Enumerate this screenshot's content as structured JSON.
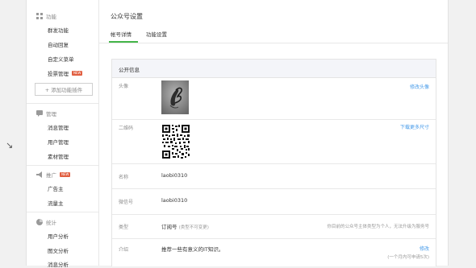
{
  "sidebar": {
    "sections": [
      {
        "title": "功能",
        "icon": "grid-icon"
      },
      {
        "title": "管理",
        "icon": "chat-icon"
      },
      {
        "title": "推广",
        "icon": "megaphone-icon",
        "badge": "NEW"
      },
      {
        "title": "统计",
        "icon": "chart-icon"
      }
    ],
    "function_items": [
      {
        "label": "群发功能"
      },
      {
        "label": "自动回复"
      },
      {
        "label": "自定义菜单"
      },
      {
        "label": "投票管理",
        "badge": "NEW"
      }
    ],
    "add_plugin_label": "+ 添加功能插件",
    "manage_items": [
      {
        "label": "消息管理"
      },
      {
        "label": "用户管理"
      },
      {
        "label": "素材管理"
      }
    ],
    "promo_items": [
      {
        "label": "广告主"
      },
      {
        "label": "流量主"
      }
    ],
    "stats_items": [
      {
        "label": "用户分析"
      },
      {
        "label": "图文分析"
      },
      {
        "label": "消息分析"
      }
    ]
  },
  "main": {
    "page_title": "公众号设置",
    "tabs": [
      {
        "label": "帐号详情",
        "active": true
      },
      {
        "label": "功能设置",
        "active": false
      }
    ],
    "panel_title": "公开信息",
    "rows": {
      "avatar": {
        "label": "头像",
        "action": "修改头像"
      },
      "qrcode": {
        "label": "二维码",
        "action": "下载更多尺寸"
      },
      "name": {
        "label": "名称",
        "value": "laobi0310"
      },
      "wechat_id": {
        "label": "微信号",
        "value": "laobi0310"
      },
      "type": {
        "label": "类型",
        "value": "订阅号",
        "value_sub": "(类型不可变更)",
        "note": "你目前的公众号主体类型为个人，无法升级为服务号"
      },
      "intro": {
        "label": "介绍",
        "value": "推荐一些有意义的IT知识。",
        "action": "修改",
        "note": "(一个月内可申请5次)"
      }
    }
  },
  "colors": {
    "accent": "#44b549",
    "link": "#459ae9",
    "badge": "#e15f41"
  }
}
